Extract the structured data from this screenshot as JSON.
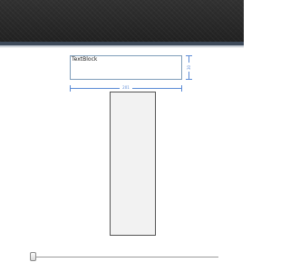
{
  "designer": {
    "textblock_text": "TextBlock",
    "height_label": "30",
    "width_label": "201"
  },
  "slider": {
    "value": 0
  },
  "colors": {
    "titlebar": "#2b2b2b",
    "accent": "#3e4a5a",
    "dimension_line": "#5b8bd6",
    "panel_fill": "#f2f2f2"
  }
}
